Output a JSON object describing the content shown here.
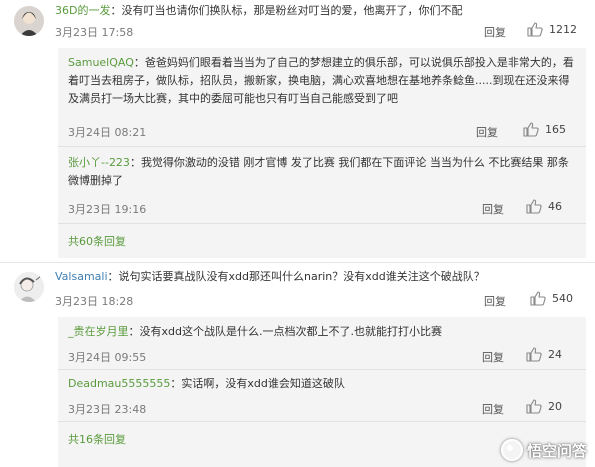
{
  "thread1": {
    "name": "36D的一发",
    "text": "没有叮当也请你们换队标，那是粉丝对叮当的爱，他离开了，你们不配",
    "date": "3月23日 17:58",
    "reply": "回复",
    "likes": "1212",
    "replies": [
      {
        "name": "SamuelQAQ",
        "text": "爸爸妈妈们眼看着当当为了自己的梦想建立的俱乐部，可以说俱乐部投入是非常大的，看着叮当去租房子，做队标，招队员，搬新家，换电脑，满心欢喜地想在基地养条鲶鱼.....到现在还没来得及满员打一场大比赛，其中的委屈可能也只有叮当自己能感受到了吧",
        "date": "3月24日 08:21",
        "reply": "回复",
        "likes": "165"
      },
      {
        "name": "张小丫--223",
        "text": "我觉得你激动的没错 刚才官博 发了比赛 我们都在下面评论 当当为什么 不比赛结果 那条微博删掉了",
        "date": "3月23日 19:16",
        "reply": "回复",
        "likes": "46"
      }
    ],
    "more": "共60条回复"
  },
  "thread2": {
    "name": "Valsamali",
    "text": "说句实话要真战队没有xdd那还叫什么narin？没有xdd谁关注这个破战队？",
    "date": "3月23日 18:28",
    "reply": "回复",
    "likes": "540",
    "replies": [
      {
        "name": "_贵在岁月里",
        "text": "没有xdd这个战队是什么.一点档次都上不了.也就能打打小比赛",
        "date": "3月24日 09:55",
        "reply": "回复",
        "likes": "24"
      },
      {
        "name": "Deadmau5555555",
        "text": "实话啊，没有xdd谁会知道这破队",
        "date": "3月23日 23:48",
        "reply": "回复",
        "likes": "20"
      }
    ],
    "more": "共16条回复"
  },
  "watermark": "悟空问答"
}
